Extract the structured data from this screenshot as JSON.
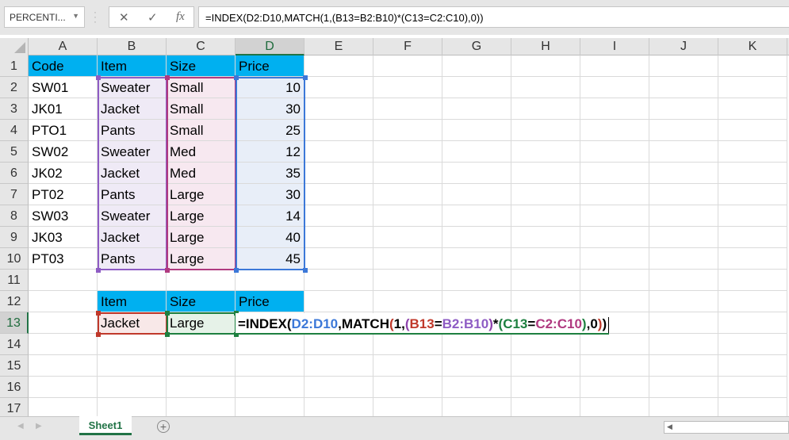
{
  "namebox": {
    "value": "PERCENTI...",
    "arrow": "▼"
  },
  "formula_bar": {
    "cancel": "✕",
    "enter": "✓",
    "fx": "fx",
    "formula": "=INDEX(D2:D10,MATCH(1,(B13=B2:B10)*(C13=C2:C10),0))"
  },
  "columns": [
    "A",
    "B",
    "C",
    "D",
    "E",
    "F",
    "G",
    "H",
    "I",
    "J",
    "K"
  ],
  "rows": [
    "1",
    "2",
    "3",
    "4",
    "5",
    "6",
    "7",
    "8",
    "9",
    "10",
    "11",
    "12",
    "13",
    "14",
    "15",
    "16",
    "17"
  ],
  "table": {
    "headers": [
      "Code",
      "Item",
      "Size",
      "Price"
    ],
    "rows": [
      [
        "SW01",
        "Sweater",
        "Small",
        "10"
      ],
      [
        "JK01",
        "Jacket",
        "Small",
        "30"
      ],
      [
        "PTO1",
        "Pants",
        "Small",
        "25"
      ],
      [
        "SW02",
        "Sweater",
        "Med",
        "12"
      ],
      [
        "JK02",
        "Jacket",
        "Med",
        "35"
      ],
      [
        "PT02",
        "Pants",
        "Large",
        "30"
      ],
      [
        "SW03",
        "Sweater",
        "Large",
        "14"
      ],
      [
        "JK03",
        "Jacket",
        "Large",
        "40"
      ],
      [
        "PT03",
        "Pants",
        "Large",
        "45"
      ]
    ]
  },
  "lookup": {
    "headers": [
      "Item",
      "Size",
      "Price"
    ],
    "item": "Jacket",
    "size": "Large"
  },
  "edit_formula": [
    {
      "t": "=INDEX(",
      "c": "#000000"
    },
    {
      "t": "D2:D10",
      "c": "#3c78d8"
    },
    {
      "t": ",MATCH",
      "c": "#000000"
    },
    {
      "t": "(",
      "c": "#c0392b"
    },
    {
      "t": "1,",
      "c": "#000000"
    },
    {
      "t": "(",
      "c": "#8e44ad"
    },
    {
      "t": "B13",
      "c": "#c0392b"
    },
    {
      "t": "=",
      "c": "#000000"
    },
    {
      "t": "B2:B10",
      "c": "#8e5cc4"
    },
    {
      "t": ")",
      "c": "#8e44ad"
    },
    {
      "t": "*",
      "c": "#000000"
    },
    {
      "t": "(",
      "c": "#1e8040"
    },
    {
      "t": "C13",
      "c": "#1e8040"
    },
    {
      "t": "=",
      "c": "#000000"
    },
    {
      "t": "C2:C10",
      "c": "#b03a80"
    },
    {
      "t": ")",
      "c": "#1e8040"
    },
    {
      "t": ",0",
      "c": "#000000"
    },
    {
      "t": ")",
      "c": "#c0392b"
    },
    {
      "t": ")",
      "c": "#000000"
    }
  ],
  "sheet_tabs": [
    "Sheet1"
  ],
  "add_sheet": "+",
  "colors": {
    "header_fill": "#00b0f0",
    "accent": "#217346"
  }
}
